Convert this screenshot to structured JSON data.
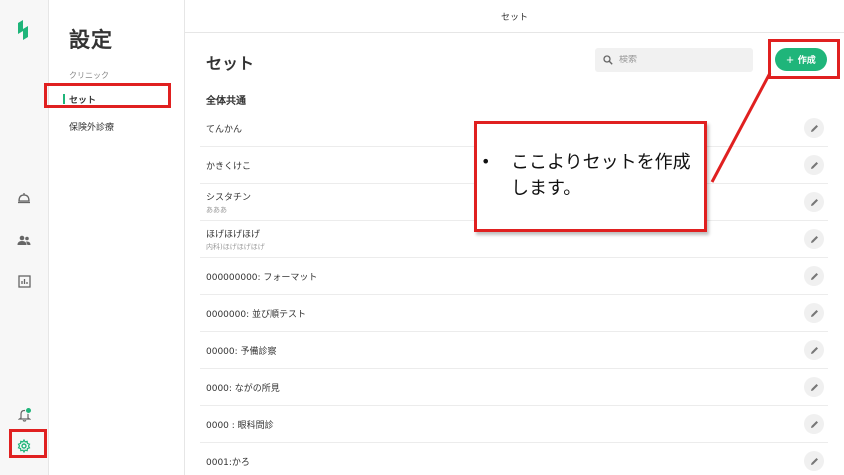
{
  "topbar": {
    "title": "セット"
  },
  "subnav": {
    "title": "設定",
    "section": "クリニック",
    "items": [
      {
        "label": "セット"
      },
      {
        "label": "保険外診療"
      }
    ]
  },
  "main": {
    "title": "セット",
    "search_placeholder": "検索",
    "create_label": "作成",
    "group_title": "全体共通",
    "rows": [
      {
        "name": "てんかん",
        "sub": ""
      },
      {
        "name": "かきくけこ",
        "sub": ""
      },
      {
        "name": "シスタチン",
        "sub": "あああ"
      },
      {
        "name": "ほげほげほげ",
        "sub": "内科)ほげほげほげ"
      },
      {
        "name": "000000000: フォーマット",
        "sub": ""
      },
      {
        "name": "0000000: 並び順テスト",
        "sub": ""
      },
      {
        "name": "00000: 予備診察",
        "sub": ""
      },
      {
        "name": "0000: ながの所見",
        "sub": ""
      },
      {
        "name": "0000 : 眼科問診",
        "sub": ""
      },
      {
        "name": "0001:かろ",
        "sub": ""
      }
    ]
  },
  "annotation": {
    "bullet": "•",
    "text": "ここよりセットを作成します。"
  },
  "colors": {
    "accent": "#1fb57a",
    "annotation": "#e02020"
  }
}
